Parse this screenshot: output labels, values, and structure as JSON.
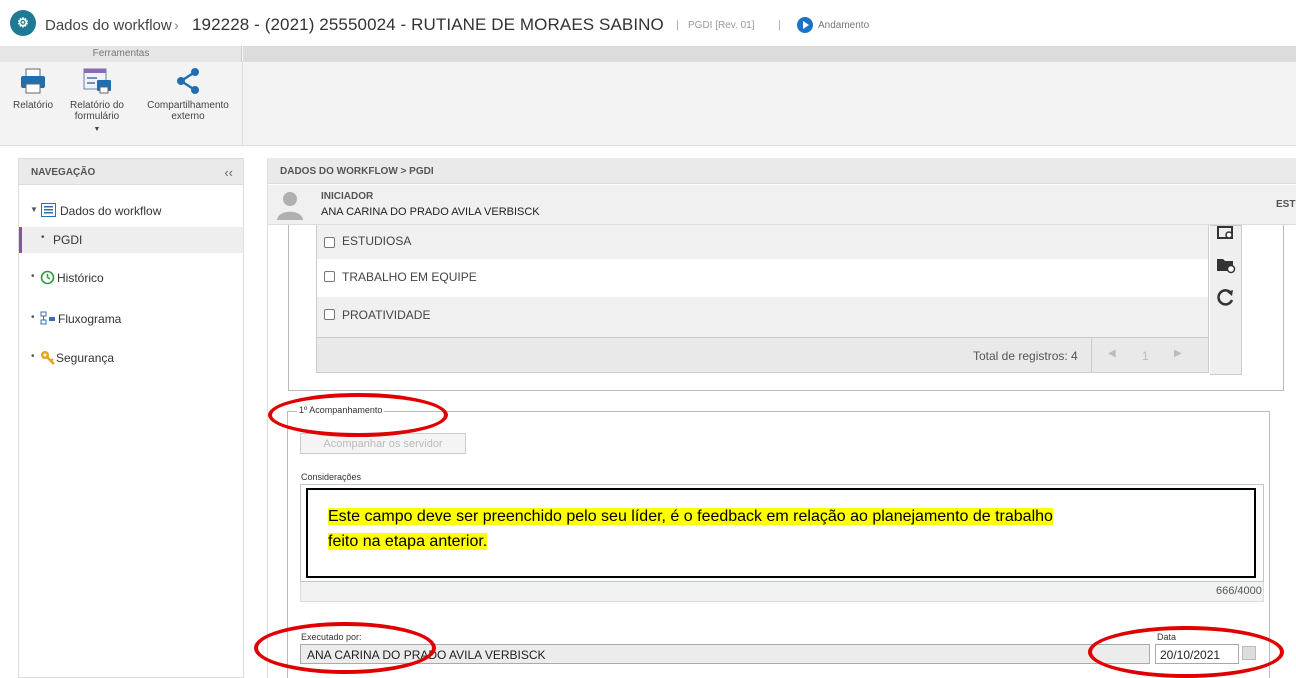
{
  "header": {
    "app_logo": "workflow-gears-icon",
    "breadcrumb_workflow": "Dados do workflow",
    "breadcrumb_separator": "›",
    "title": "192228 - (2021) 25550024 - RUTIANE DE MORAES SABINO",
    "separator": "|",
    "revision": "PGDI [Rev. 01]",
    "status": "Andamento",
    "status_color": "#1a73c7"
  },
  "ribbon": {
    "group_label": "Ferramentas",
    "tools": [
      {
        "label_line1": "Relatório",
        "label_line2": "",
        "icon": "printer-icon"
      },
      {
        "label_line1": "Relatório do",
        "label_line2": "formulário",
        "icon": "form-report-icon",
        "has_dropdown": true
      },
      {
        "label_line1": "Compartilhamento",
        "label_line2": "externo",
        "icon": "share-icon"
      }
    ]
  },
  "nav": {
    "title": "NAVEGAÇÃO",
    "collapse_glyph": "‹‹",
    "items": [
      {
        "label": "Dados do workflow",
        "icon": "list-document-icon",
        "expanded": true
      },
      {
        "label": "PGDI",
        "active": true
      },
      {
        "label": "Histórico",
        "icon": "history-icon"
      },
      {
        "label": "Fluxograma",
        "icon": "flowchart-icon"
      },
      {
        "label": "Segurança",
        "icon": "key-icon"
      }
    ]
  },
  "content": {
    "breadcrumb": "DADOS DO WORKFLOW  >  PGDI",
    "initiator_label": "INICIADOR",
    "initiator_name": "ANA CARINA DO PRADO AVILA VERBISCK",
    "right_label": "ESTE",
    "grid_rows": [
      "ESTUDIOSA",
      "TRABALHO EM EQUIPE",
      "PROATIVIDADE"
    ],
    "total_records": "Total de registros: 4",
    "page_number": "1",
    "section_legend": "1º Acompanhamento",
    "disabled_button": "Acompanhar os servidor",
    "considerations_label": "Considerações",
    "considerations_text_line1": "Este campo deve ser preenchido pelo seu líder, é o feedback em relação ao planejamento de trabalho",
    "considerations_text_line2": "feito na etapa anterior.",
    "char_counter": "666/4000",
    "executed_by_label": "Executado por:",
    "executed_by_value": "ANA CARINA DO PRADO AVILA VERBISCK",
    "date_label": "Data",
    "date_value": "20/10/2021"
  },
  "colors": {
    "annotation": "#e00000",
    "highlight": "#ffff00",
    "nav_active_bar": "#8a4fa8",
    "logo": "#1f7a96"
  }
}
